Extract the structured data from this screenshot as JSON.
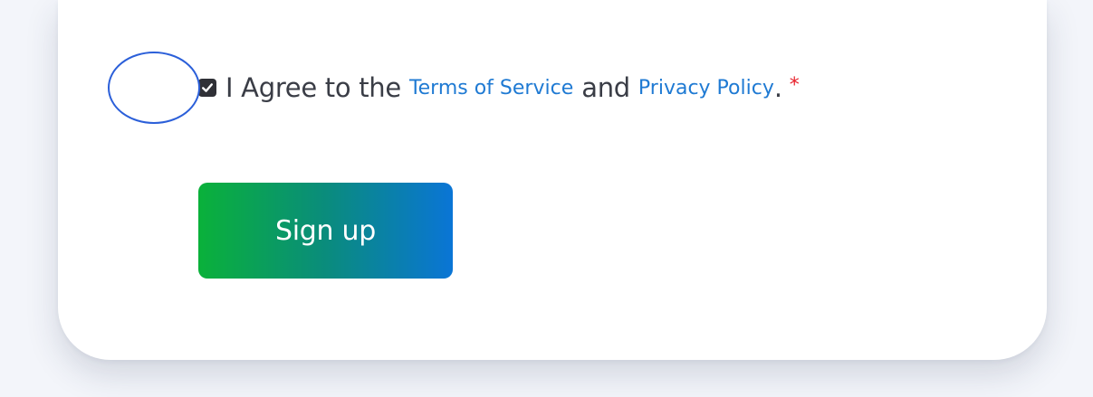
{
  "form": {
    "agree": {
      "checked": true,
      "prefix": "I Agree to the",
      "terms_link": "Terms of Service",
      "conjunction": "and",
      "privacy_link": "Privacy Policy",
      "suffix": ".",
      "required_mark": "*"
    },
    "signup_button_label": "Sign up"
  },
  "icons": {
    "checkbox": "checkmark-icon",
    "highlight": "focus-ring-annotation"
  },
  "colors": {
    "background": "#f3f5fa",
    "card": "#ffffff",
    "text": "#3a3d46",
    "link": "#1f7ad3",
    "required": "#e8222c",
    "button_gradient_start": "#0ab13a",
    "button_gradient_end": "#0a75d6",
    "annotation_ring": "#2b5fd9"
  }
}
